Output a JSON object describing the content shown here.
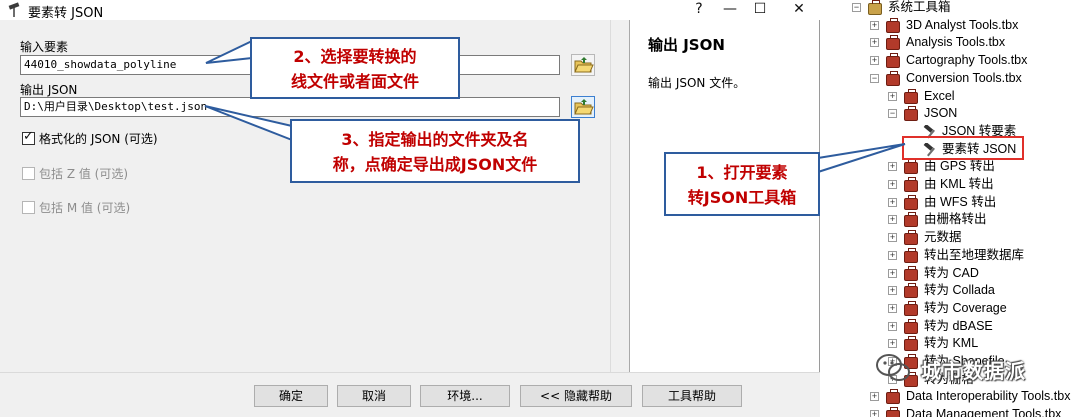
{
  "window": {
    "title": "要素转 JSON",
    "controls": {
      "help": "?",
      "minimize": "—",
      "maximize": "☐",
      "close": "✕"
    }
  },
  "form": {
    "input_features_label": "输入要素",
    "input_features_value": "44010_showdata_polyline",
    "output_json_label": "输出 JSON",
    "output_json_value": "D:\\用户目录\\Desktop\\test.json",
    "options": [
      {
        "label": "格式化的 JSON (可选)",
        "checked": true,
        "enabled": true
      },
      {
        "label": "包括 Z 值 (可选)",
        "checked": false,
        "enabled": false
      },
      {
        "label": "包括 M 值 (可选)",
        "checked": false,
        "enabled": false
      }
    ]
  },
  "buttons": {
    "ok": "确定",
    "cancel": "取消",
    "environments": "环境...",
    "hide_help": "<< 隐藏帮助",
    "tool_help": "工具帮助"
  },
  "help_panel": {
    "title": "输出 JSON",
    "description": "输出 JSON 文件。"
  },
  "callouts": {
    "step1": [
      "1、打开要素",
      "转JSON工具箱"
    ],
    "step2": [
      "2、选择要转换的",
      "线文件或者面文件"
    ],
    "step3": [
      "3、指定输出的文件夹及名",
      "称，点确定导出成JSON文件"
    ]
  },
  "tree": {
    "root": "系统工具箱",
    "toolboxes_top": [
      "3D Analyst Tools.tbx",
      "Analysis Tools.tbx",
      "Cartography Tools.tbx",
      "Conversion Tools.tbx"
    ],
    "conversion_children": [
      "Excel",
      "JSON"
    ],
    "json_tools": [
      "JSON 转要素",
      "要素转 JSON"
    ],
    "conversion_more": [
      "由 GPS 转出",
      "由 KML 转出",
      "由 WFS 转出",
      "由栅格转出",
      "元数据",
      "转出至地理数据库",
      "转为 CAD",
      "转为 Collada",
      "转为 Coverage",
      "转为 dBASE",
      "转为 KML",
      "转为 Shapefile",
      "转为栅格"
    ],
    "toolboxes_bottom": [
      "Data Interoperability Tools.tbx",
      "Data Management Tools.tbx"
    ]
  },
  "watermark": "城市数据派",
  "colors": {
    "callout_border": "#2e5c9e",
    "callout_text": "#c00000",
    "highlight": "#e0302a",
    "toolbox_icon": "#b23a2a"
  }
}
